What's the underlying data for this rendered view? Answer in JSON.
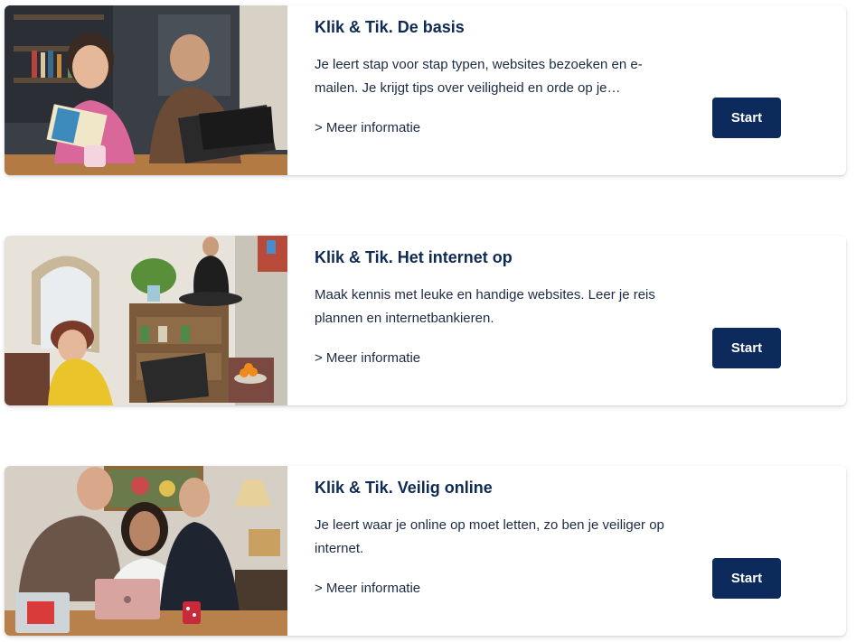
{
  "courses": [
    {
      "title": "Klik & Tik. De basis",
      "description": "Je leert stap voor stap typen, websites bezoeken en e-mailen. Je krijgt tips over veiligheid en orde op je…",
      "more_label": "> Meer informatie",
      "start_label": "Start"
    },
    {
      "title": "Klik & Tik. Het internet op",
      "description": "Maak kennis met leuke en handige websites. Leer je reis plannen en internetbankieren.",
      "more_label": "> Meer informatie",
      "start_label": "Start"
    },
    {
      "title": "Klik & Tik. Veilig online",
      "description": "Je leert waar je online op moet letten, zo ben je veiliger op internet.",
      "more_label": "> Meer informatie",
      "start_label": "Start"
    }
  ],
  "colors": {
    "accent": "#0c2a5b",
    "title": "#0e2a55",
    "text": "#1c2b45"
  }
}
